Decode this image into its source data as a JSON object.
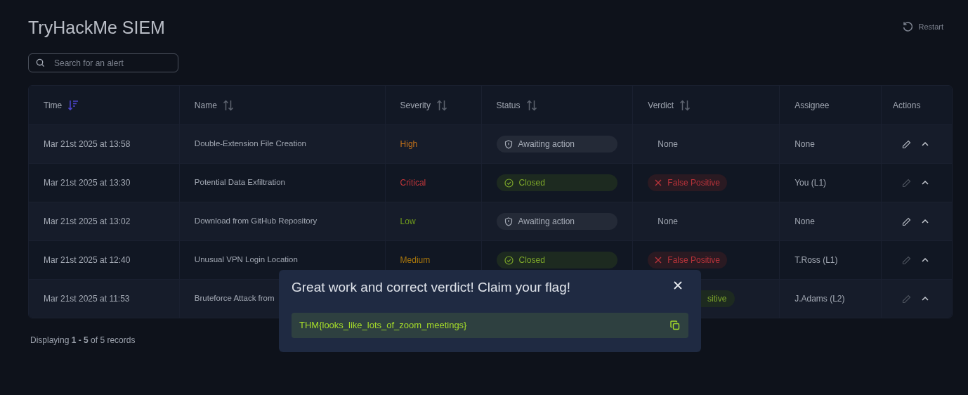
{
  "title": "TryHackMe SIEM",
  "restart": "Restart",
  "search": {
    "placeholder": "Search for an alert"
  },
  "columns": [
    {
      "label": "Time",
      "sorted": true
    },
    {
      "label": "Name",
      "sorted": false
    },
    {
      "label": "Severity",
      "sorted": false
    },
    {
      "label": "Status",
      "sorted": false
    },
    {
      "label": "Verdict",
      "sorted": false
    },
    {
      "label": "Assignee"
    },
    {
      "label": "Actions"
    }
  ],
  "rows": [
    {
      "time": "Mar 21st 2025 at 13:58",
      "name": "Double-Extension File Creation",
      "severity": {
        "label": "High",
        "color": "#c2711a"
      },
      "status": {
        "kind": "awaiting",
        "label": "Awaiting action"
      },
      "verdict": {
        "kind": "none",
        "label": "None"
      },
      "assignee": "None",
      "editable": true
    },
    {
      "time": "Mar 21st 2025 at 13:30",
      "name": "Potential Data Exfiltration",
      "severity": {
        "label": "Critical",
        "color": "#c0363a"
      },
      "status": {
        "kind": "closed",
        "label": "Closed"
      },
      "verdict": {
        "kind": "false_positive",
        "label": "False Positive"
      },
      "assignee": "You (L1)",
      "editable": false
    },
    {
      "time": "Mar 21st 2025 at 13:02",
      "name": "Download from GitHub Repository",
      "severity": {
        "label": "Low",
        "color": "#6f9a1c"
      },
      "status": {
        "kind": "awaiting",
        "label": "Awaiting action"
      },
      "verdict": {
        "kind": "none",
        "label": "None"
      },
      "assignee": "None",
      "editable": true
    },
    {
      "time": "Mar 21st 2025 at 12:40",
      "name": "Unusual VPN Login Location",
      "severity": {
        "label": "Medium",
        "color": "#a8760c"
      },
      "status": {
        "kind": "closed",
        "label": "Closed"
      },
      "verdict": {
        "kind": "false_positive",
        "label": "False Positive"
      },
      "assignee": "T.Ross (L1)",
      "editable": false
    },
    {
      "time": "Mar 21st 2025 at 11:53",
      "name": "Bruteforce Attack from",
      "verdict": {
        "kind": "true_positive",
        "label": "sitive"
      },
      "assignee": "J.Adams (L2)",
      "editable": false
    }
  ],
  "footer": "Displaying **1 - 5** of 5 records",
  "modal": {
    "title": "Great work and correct verdict! Claim your flag!",
    "flag": "THM{looks_like_lots_of_zoom_meetings}"
  }
}
